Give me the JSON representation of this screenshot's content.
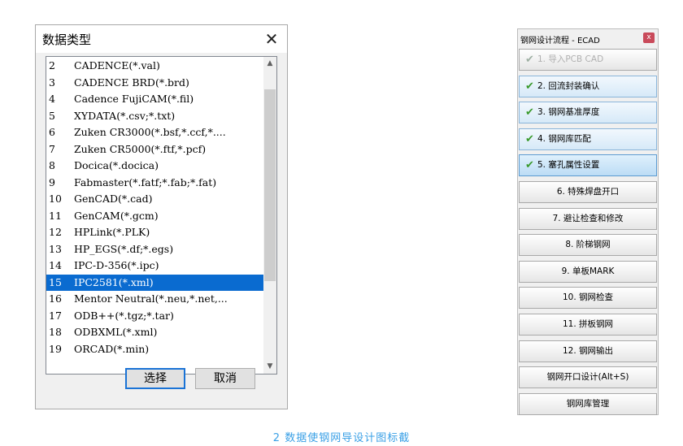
{
  "dialog": {
    "title": "数据类型",
    "close_glyph": "✕",
    "items": [
      {
        "num": "2",
        "name": "CADENCE(*.val)"
      },
      {
        "num": "3",
        "name": "CADENCE BRD(*.brd)"
      },
      {
        "num": "4",
        "name": "Cadence FujiCAM(*.fil)"
      },
      {
        "num": "5",
        "name": "XYDATA(*.csv;*.txt)"
      },
      {
        "num": "6",
        "name": "Zuken CR3000(*.bsf,*.ccf,*...."
      },
      {
        "num": "7",
        "name": "Zuken CR5000(*.ftf,*.pcf)"
      },
      {
        "num": "8",
        "name": "Docica(*.docica)"
      },
      {
        "num": "9",
        "name": "Fabmaster(*.fatf;*.fab;*.fat)"
      },
      {
        "num": "10",
        "name": "GenCAD(*.cad)"
      },
      {
        "num": "11",
        "name": "GenCAM(*.gcm)"
      },
      {
        "num": "12",
        "name": "HPLink(*.PLK)"
      },
      {
        "num": "13",
        "name": "HP_EGS(*.df;*.egs)"
      },
      {
        "num": "14",
        "name": "IPC-D-356(*.ipc)"
      },
      {
        "num": "15",
        "name": "IPC2581(*.xml)"
      },
      {
        "num": "16",
        "name": "Mentor Neutral(*.neu,*.net,..."
      },
      {
        "num": "17",
        "name": "ODB++(*.tgz;*.tar)"
      },
      {
        "num": "18",
        "name": "ODBXML(*.xml)"
      },
      {
        "num": "19",
        "name": "ORCAD(*.min)"
      }
    ],
    "selected_num": "15",
    "scroll_up_glyph": "▲",
    "scroll_down_glyph": "▼",
    "ok_label": "选择",
    "cancel_label": "取消"
  },
  "flow_panel": {
    "title": "钢网设计流程 - ECAD",
    "close_glyph": "x",
    "check_glyph": "✔",
    "steps": [
      {
        "label": "1. 导入PCB CAD",
        "checked": true,
        "state": "disabled"
      },
      {
        "label": "2. 回流封装确认",
        "checked": true,
        "state": "done"
      },
      {
        "label": "3. 钢网基准厚度",
        "checked": true,
        "state": "done"
      },
      {
        "label": "4. 钢网库匹配",
        "checked": true,
        "state": "done"
      },
      {
        "label": "5. 塞孔属性设置",
        "checked": true,
        "state": "active"
      },
      {
        "label": "6. 特殊焊盘开口",
        "checked": false,
        "state": "normal"
      },
      {
        "label": "7. 避让检查和修改",
        "checked": false,
        "state": "normal"
      },
      {
        "label": "8. 阶梯钢网",
        "checked": false,
        "state": "normal"
      },
      {
        "label": "9. 单板MARK",
        "checked": false,
        "state": "normal"
      },
      {
        "label": "10. 钢网检查",
        "checked": false,
        "state": "normal"
      },
      {
        "label": "11. 拼板钢网",
        "checked": false,
        "state": "normal"
      },
      {
        "label": "12. 钢网输出",
        "checked": false,
        "state": "normal"
      },
      {
        "label": "钢网开口设计(Alt+S)",
        "checked": false,
        "state": "normal"
      },
      {
        "label": "钢网库管理",
        "checked": false,
        "state": "normal"
      }
    ]
  },
  "caption": "2 数据使钢网导设计图标截"
}
